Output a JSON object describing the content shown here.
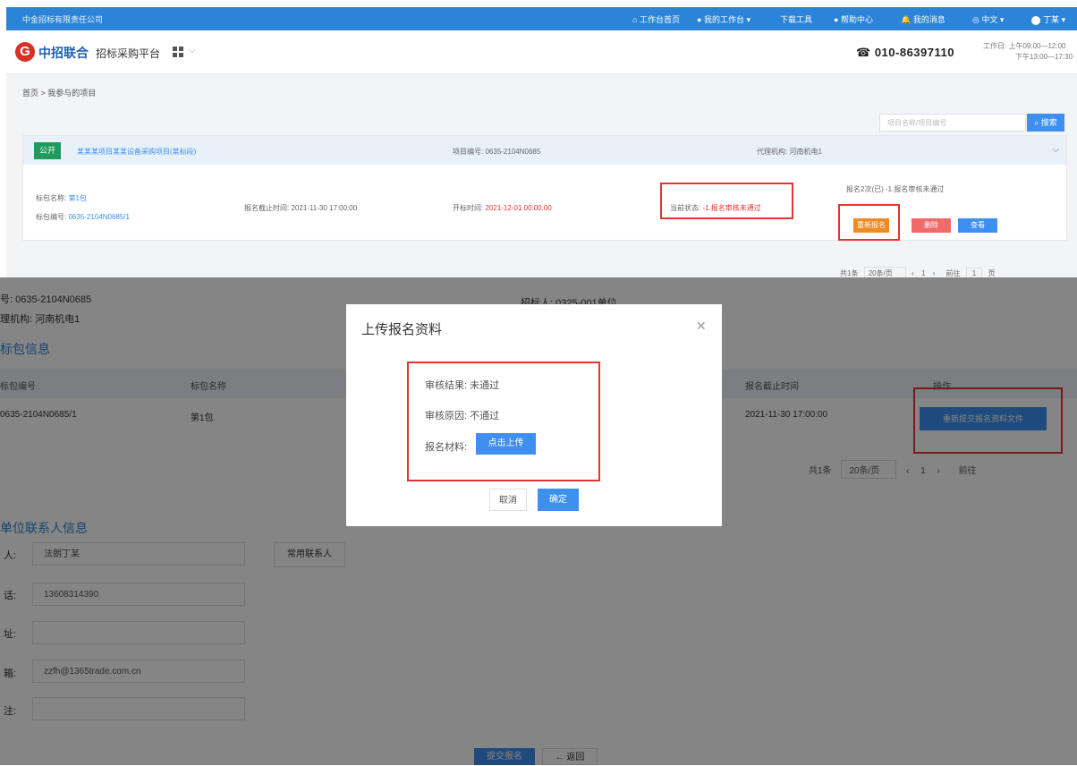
{
  "top_window": {
    "topbar": {
      "company": "中金招标有限责任公司",
      "nav": [
        "工作台首页",
        "我的工作台",
        "下载工具",
        "帮助中心",
        "我的消息",
        "中文",
        "丁某"
      ]
    },
    "header": {
      "brand": "中招联合",
      "system": "招标采购平台",
      "hotline": "010-86397110",
      "worktime_line1": "工作日: 上午09:00—12:00",
      "worktime_line2": "下午13:00—17:30"
    },
    "breadcrumb": "首页 > 我参与的项目",
    "search": {
      "placeholder": "项目名称/项目编号",
      "button": "搜索"
    },
    "project": {
      "tag": "公开",
      "title": "某某某项目某某设备采购项目(某标段)",
      "project_no_label": "项目编号:",
      "project_no": "0635-2104N0685",
      "agency_label": "代理机构:",
      "agency": "河南机电1",
      "lot_name_label": "标包名称:",
      "lot_name": "第1包",
      "lot_no_label": "标包编号:",
      "lot_no": "0635-2104N0685/1",
      "deadline_label": "报名截止时间:",
      "deadline": "2021-11-30 17:00:00",
      "open_label": "开标时间:",
      "open_time": "2021-12-01 00:00:00",
      "status_label": "当前状态:",
      "status": "-1.报名审核未通过",
      "progress_note": "报名2次(已) -1.报名审核未通过",
      "btn_upload": "重新报名",
      "btn_delete": "删除",
      "btn_view": "查看"
    },
    "pager": {
      "total": "共1条",
      "page_size": "20条/页",
      "current": "1",
      "goto_label": "前往",
      "goto_value": "1",
      "page_unit": "页"
    }
  },
  "background_page": {
    "project_no_label": "号: 0635-2104N0685",
    "bidder_label": "招标人: 0325-001单位",
    "agency_label": "理机构: 河南机电1",
    "section_lot": "标包信息",
    "table_headers": [
      "标包编号",
      "标包名称",
      "报名截止时间",
      "操作"
    ],
    "row": {
      "lot_no": "0635-2104N0685/1",
      "lot_name": "第1包",
      "deadline": "2021-11-30 17:00:00",
      "action": "重新提交报名资料文件"
    },
    "pager": {
      "total": "共1条",
      "page_size": "20条/页",
      "current": "1",
      "goto_label": "前往"
    },
    "section_contact": "单位联系人信息",
    "contact": [
      {
        "label": "人:",
        "value": "法朗丁某"
      },
      {
        "label": "话:",
        "value": "13608314390"
      },
      {
        "label": "址:",
        "value": ""
      },
      {
        "label": "箱:",
        "value": "zzfh@1365trade.com.cn"
      },
      {
        "label": "注:",
        "value": ""
      }
    ],
    "contact_btn": "常用联系人",
    "submit_btn": "提交报名",
    "back_btn": "返回"
  },
  "modal": {
    "title": "上传报名资料",
    "review_result_label": "审核结果:",
    "review_result": "未通过",
    "review_reason_label": "审核原因:",
    "review_reason": "不通过",
    "material_label": "报名材料:",
    "upload_button": "点击上传",
    "cancel": "取消",
    "confirm": "确定"
  }
}
